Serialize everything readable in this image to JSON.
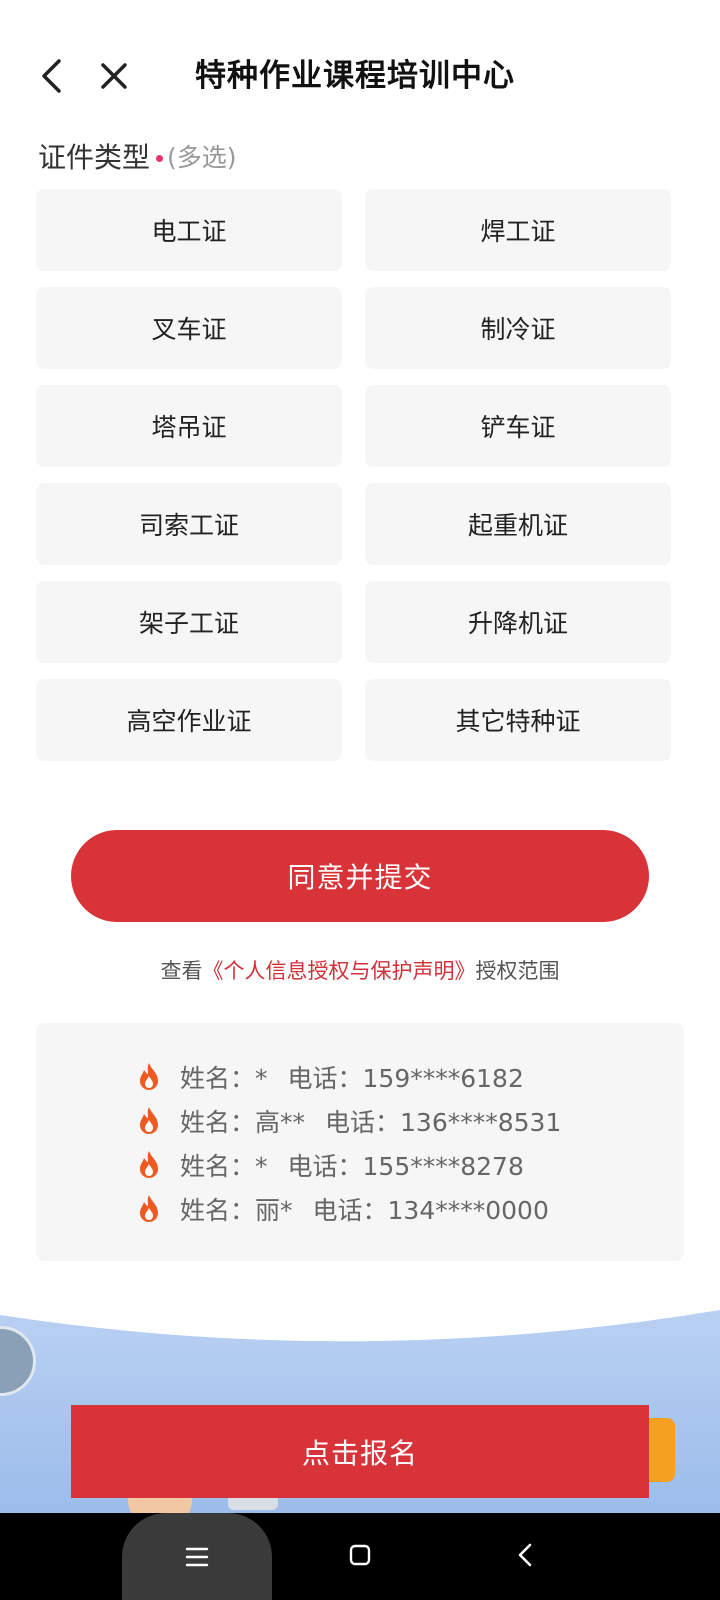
{
  "header": {
    "title": "特种作业课程培训中心",
    "back_icon": "chevron-left-icon",
    "close_icon": "close-icon"
  },
  "form": {
    "label": "证件类型",
    "hint": "(多选)",
    "options": [
      "电工证",
      "焊工证",
      "叉车证",
      "制冷证",
      "塔吊证",
      "铲车证",
      "司索工证",
      "起重机证",
      "架子工证",
      "升降机证",
      "高空作业证",
      "其它特种证"
    ]
  },
  "submit": {
    "label": "同意并提交"
  },
  "consent": {
    "prefix": "查看",
    "link": "《个人信息授权与保护声明》",
    "suffix": "授权范围"
  },
  "records": [
    {
      "name": "姓名：*",
      "phone": "电话：159****6182"
    },
    {
      "name": "姓名：高**",
      "phone": "电话：136****8531"
    },
    {
      "name": "姓名：*",
      "phone": "电话：155****8278"
    },
    {
      "name": "姓名：丽*",
      "phone": "电话：134****0000"
    }
  ],
  "cta": {
    "label": "点击报名"
  },
  "navbar": {
    "menu_icon": "menu-icon",
    "home_icon": "home-square-icon",
    "back_icon": "back-triangle-icon"
  },
  "colors": {
    "accent": "#d9333a",
    "option_bg": "#f6f6f6",
    "fire": "#f05a22",
    "required_dot": "#e8336b"
  }
}
